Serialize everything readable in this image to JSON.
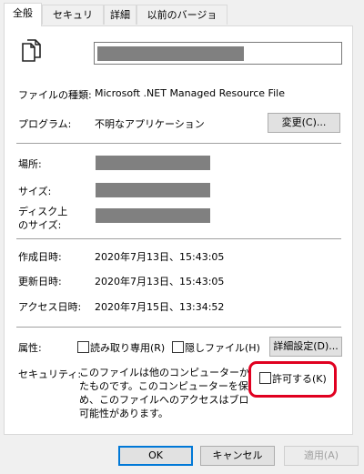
{
  "tabs": [
    {
      "label": "全般"
    },
    {
      "label": "セキュリティ"
    },
    {
      "label": "詳細"
    },
    {
      "label": "以前のバージョン"
    }
  ],
  "file_icon": "file-documents-icon",
  "file_type": {
    "label": "ファイルの種類:",
    "value": "Microsoft .NET Managed Resource File"
  },
  "program": {
    "label": "プログラム:",
    "value": "不明なアプリケーション",
    "change_button": "変更(C)..."
  },
  "location": {
    "label": "場所:"
  },
  "size": {
    "label": "サイズ:"
  },
  "disk_size": {
    "label_line1": "ディスク上",
    "label_line2": "のサイズ:"
  },
  "created": {
    "label": "作成日時:",
    "value": "2020年7月13日、15:43:05"
  },
  "modified": {
    "label": "更新日時:",
    "value": "2020年7月13日、15:43:05"
  },
  "accessed": {
    "label": "アクセス日時:",
    "value": "2020年7月15日、13:34:52"
  },
  "attributes": {
    "label": "属性:",
    "readonly": "読み取り専用(R)",
    "hidden": "隠しファイル(H)",
    "advanced_button": "詳細設定(D)..."
  },
  "security": {
    "label": "セキュリティ:",
    "lines": [
      "このファイルは他のコンピューターから取得し",
      "たものです。このコンピューターを保護するた",
      "め、このファイルへのアクセスはブロックされる",
      "可能性があります。"
    ],
    "allow": "許可する(K)",
    "highlight_color": "#e00020"
  },
  "footer": {
    "ok": "OK",
    "cancel": "キャンセル",
    "apply": "適用(A)"
  }
}
